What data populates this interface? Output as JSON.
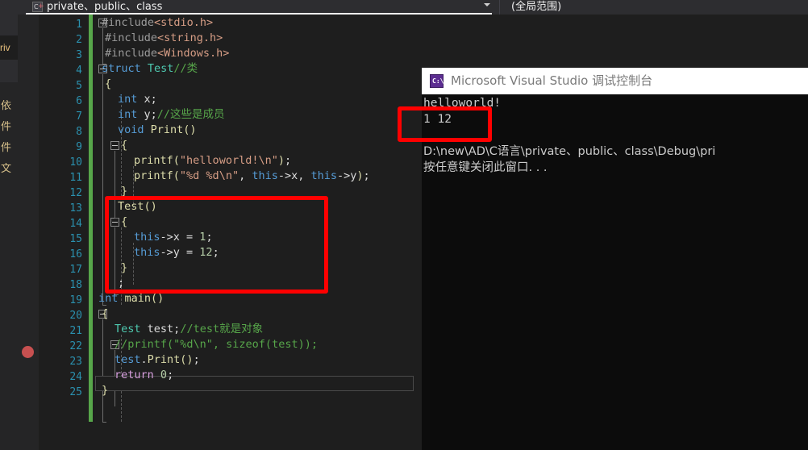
{
  "window": {
    "title": "Microsoft Visual Studio"
  },
  "left_panel": {
    "dropdown_icon": "chevron-down-icon",
    "clipped_label": "riv",
    "cursor_icon": "mouse-cursor-icon",
    "clipped_items": [
      "依",
      "件",
      "件",
      "文"
    ]
  },
  "tabbar": {
    "tab_icon": "cpp-file-icon",
    "tab_title": "private、public、class",
    "dropdown_icon": "chevron-down-icon",
    "scope_value": "(全局范围)"
  },
  "editor": {
    "breakpoint": {
      "icon": "breakpoint-dot",
      "line": 22
    },
    "current_line": 23,
    "line_numbers": [
      1,
      2,
      3,
      4,
      5,
      6,
      7,
      8,
      9,
      10,
      11,
      12,
      13,
      14,
      15,
      16,
      17,
      18,
      19,
      20,
      21,
      22,
      23,
      24,
      25
    ],
    "lines": [
      {
        "n": 1,
        "tokens": [
          {
            "t": "#include",
            "c": "pp"
          },
          {
            "t": "<stdio.h>",
            "c": "str"
          }
        ]
      },
      {
        "n": 2,
        "tokens": [
          {
            "t": "#include",
            "c": "pp"
          },
          {
            "t": "<string.h>",
            "c": "str"
          }
        ]
      },
      {
        "n": 3,
        "tokens": [
          {
            "t": "#include",
            "c": "pp"
          },
          {
            "t": "<Windows.h>",
            "c": "str"
          }
        ]
      },
      {
        "n": 4,
        "tokens": [
          {
            "t": "struct ",
            "c": "k"
          },
          {
            "t": "Test",
            "c": "typ"
          },
          {
            "t": "//类",
            "c": "cmt"
          }
        ]
      },
      {
        "n": 5,
        "tokens": [
          {
            "t": "{",
            "c": "br"
          }
        ]
      },
      {
        "n": 6,
        "tokens": [
          {
            "t": "int",
            "c": "k"
          },
          {
            "t": " x;",
            "c": "pl"
          }
        ]
      },
      {
        "n": 7,
        "tokens": [
          {
            "t": "int",
            "c": "k"
          },
          {
            "t": " y;",
            "c": "pl"
          },
          {
            "t": "//这些是成员",
            "c": "cmt"
          }
        ]
      },
      {
        "n": 8,
        "tokens": [
          {
            "t": "void ",
            "c": "k"
          },
          {
            "t": "Print",
            "c": "fn"
          },
          {
            "t": "()",
            "c": "br"
          }
        ]
      },
      {
        "n": 9,
        "tokens": [
          {
            "t": "{",
            "c": "br"
          }
        ]
      },
      {
        "n": 10,
        "tokens": [
          {
            "t": "printf",
            "c": "fn"
          },
          {
            "t": "(",
            "c": "br"
          },
          {
            "t": "\"helloworld!\\n\"",
            "c": "str"
          },
          {
            "t": ")",
            "c": "br"
          },
          {
            "t": ";",
            "c": "pl"
          }
        ]
      },
      {
        "n": 11,
        "tokens": [
          {
            "t": "printf",
            "c": "fn"
          },
          {
            "t": "(",
            "c": "br"
          },
          {
            "t": "\"%d %d\\n\"",
            "c": "str"
          },
          {
            "t": ", ",
            "c": "pl"
          },
          {
            "t": "this",
            "c": "k"
          },
          {
            "t": "->x, ",
            "c": "pl"
          },
          {
            "t": "this",
            "c": "k"
          },
          {
            "t": "->y",
            "c": "pl"
          },
          {
            "t": ")",
            "c": "br"
          },
          {
            "t": ";",
            "c": "pl"
          }
        ]
      },
      {
        "n": 12,
        "tokens": [
          {
            "t": "}",
            "c": "br"
          }
        ]
      },
      {
        "n": 13,
        "tokens": [
          {
            "t": "Test",
            "c": "fn"
          },
          {
            "t": "()",
            "c": "br"
          }
        ]
      },
      {
        "n": 14,
        "tokens": [
          {
            "t": "{",
            "c": "br"
          }
        ]
      },
      {
        "n": 15,
        "tokens": [
          {
            "t": "this",
            "c": "k"
          },
          {
            "t": "->x = ",
            "c": "pl"
          },
          {
            "t": "1",
            "c": "num"
          },
          {
            "t": ";",
            "c": "pl"
          }
        ]
      },
      {
        "n": 16,
        "tokens": [
          {
            "t": "this",
            "c": "k"
          },
          {
            "t": "->y = ",
            "c": "pl"
          },
          {
            "t": "12",
            "c": "num"
          },
          {
            "t": ";",
            "c": "pl"
          }
        ]
      },
      {
        "n": 17,
        "tokens": [
          {
            "t": "}",
            "c": "br"
          }
        ]
      },
      {
        "n": 18,
        "tokens": [
          {
            "t": ";",
            "c": "pl"
          }
        ]
      },
      {
        "n": 19,
        "tokens": [
          {
            "t": "int ",
            "c": "k"
          },
          {
            "t": "main",
            "c": "fn"
          },
          {
            "t": "()",
            "c": "br"
          }
        ]
      },
      {
        "n": 20,
        "tokens": [
          {
            "t": "{",
            "c": "br"
          }
        ]
      },
      {
        "n": 21,
        "tokens": [
          {
            "t": "Test",
            "c": "typ"
          },
          {
            "t": " ",
            "c": "pl"
          },
          {
            "t": "test",
            "c": "pl"
          },
          {
            "t": ";",
            "c": "pl"
          },
          {
            "t": "//test就是对象",
            "c": "cmt"
          }
        ]
      },
      {
        "n": 22,
        "tokens": [
          {
            "t": "//printf(\"%d\\n\", sizeof(test));",
            "c": "cmt"
          }
        ]
      },
      {
        "n": 23,
        "tokens": [
          {
            "t": "test",
            "c": "k"
          },
          {
            "t": ".",
            "c": "pl"
          },
          {
            "t": "Print",
            "c": "fn"
          },
          {
            "t": "()",
            "c": "br"
          },
          {
            "t": ";",
            "c": "pl"
          }
        ]
      },
      {
        "n": 24,
        "tokens": [
          {
            "t": "return",
            "c": "ctl"
          },
          {
            "t": " ",
            "c": "pl"
          },
          {
            "t": "0",
            "c": "num"
          },
          {
            "t": ";",
            "c": "pl"
          }
        ]
      },
      {
        "n": 25,
        "tokens": [
          {
            "t": "}",
            "c": "br"
          }
        ]
      }
    ]
  },
  "console": {
    "icon": "console-app-icon",
    "icon_text": "C:\\",
    "title": "Microsoft Visual Studio 调试控制台",
    "output_lines": [
      "helloworld!",
      "1 12",
      "",
      "D:\\new\\AD\\C语言\\private、public、class\\Debug\\pri",
      "按任意键关闭此窗口. . ."
    ]
  },
  "annotations": {
    "code_box_label": "constructor-highlight",
    "console_box_label": "output-values-highlight"
  },
  "colors": {
    "accent_red": "#ff0000",
    "editor_bg": "#1e1e1e",
    "console_bg": "#0c0c0c",
    "changebar_green": "#57a64a",
    "linenum_blue": "#2b91af",
    "breakpoint_red": "#c75050"
  }
}
